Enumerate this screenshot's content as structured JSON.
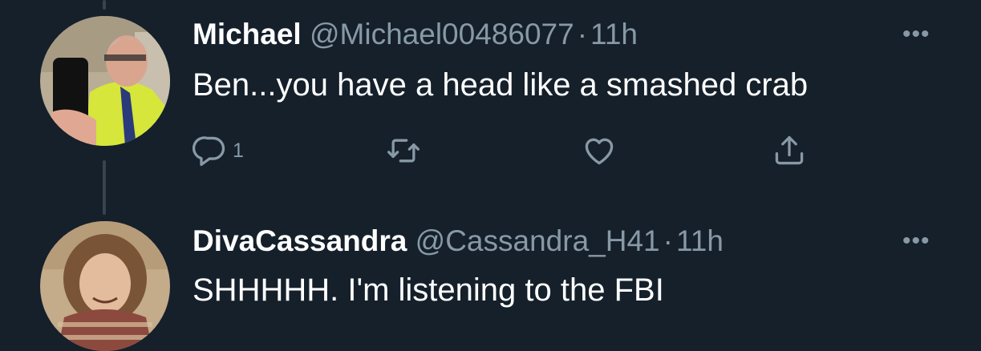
{
  "tweets": [
    {
      "name": "Michael",
      "handle": "@Michael00486077",
      "separator": "·",
      "time": "11h",
      "text": "Ben...you have a head like a smashed crab",
      "more": "•••",
      "actions": {
        "reply_count": "1"
      }
    },
    {
      "name": "DivaCassandra",
      "handle": "@Cassandra_H41",
      "separator": "·",
      "time": "11h",
      "text": "SHHHHH.  I'm listening to the FBI",
      "more": "•••"
    }
  ],
  "icons": [
    "reply-icon",
    "retweet-icon",
    "like-icon",
    "share-icon",
    "more-icon"
  ],
  "colors": {
    "background": "#15202b",
    "secondary_text": "#8899a6",
    "thread_line": "#38444d"
  }
}
